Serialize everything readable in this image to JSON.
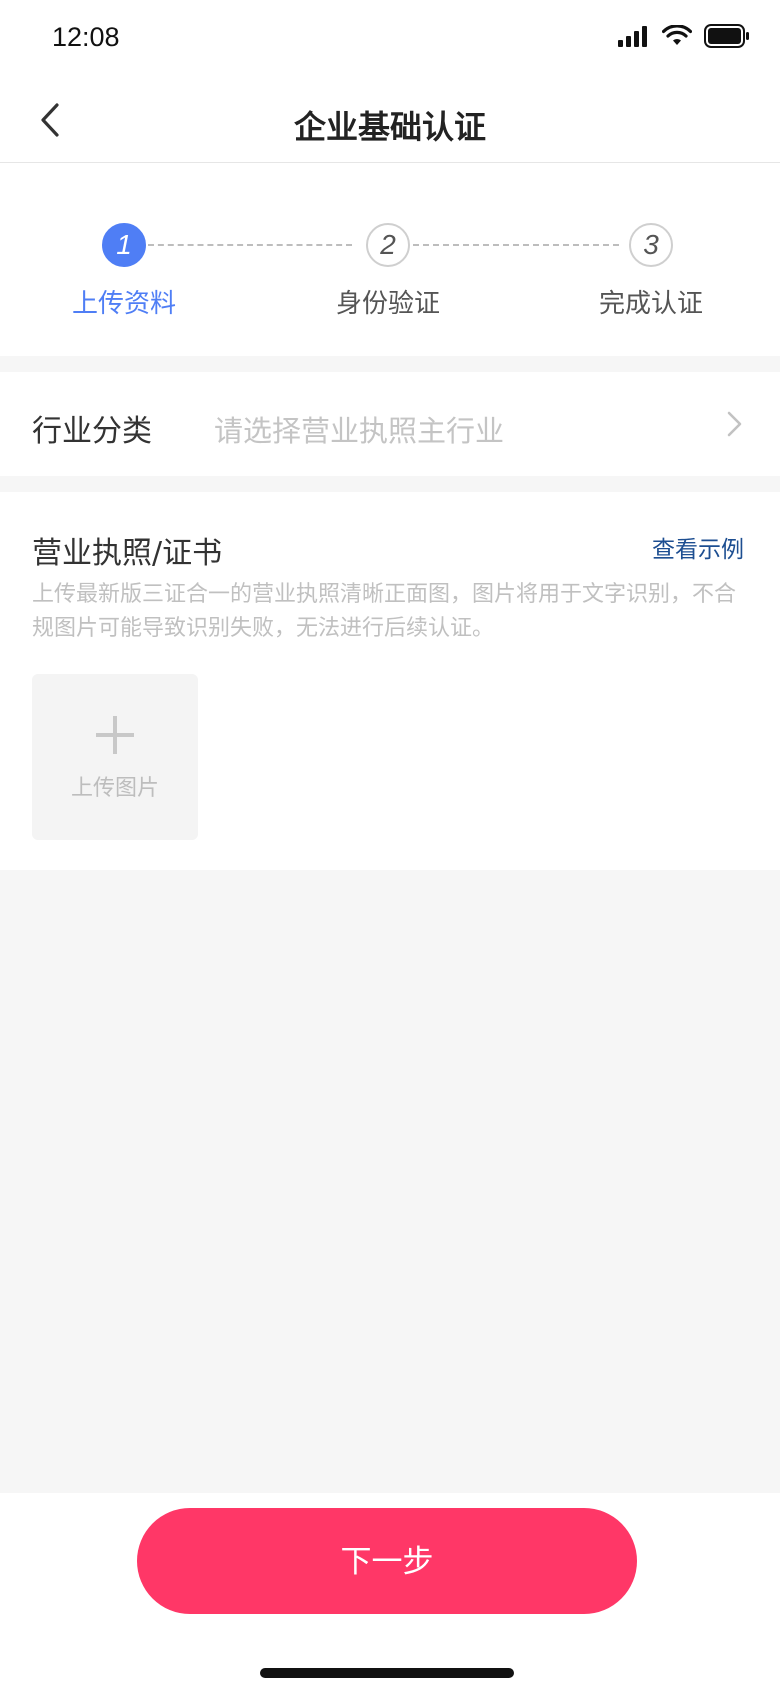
{
  "status_bar": {
    "time": "12:08"
  },
  "nav": {
    "title": "企业基础认证"
  },
  "steps": [
    {
      "number": "1",
      "label": "上传资料",
      "active": true
    },
    {
      "number": "2",
      "label": "身份验证",
      "active": false
    },
    {
      "number": "3",
      "label": "完成认证",
      "active": false
    }
  ],
  "industry": {
    "label": "行业分类",
    "placeholder": "请选择营业执照主行业"
  },
  "license": {
    "title": "营业执照/证书",
    "example_link": "查看示例",
    "description": "上传最新版三证合一的营业执照清晰正面图，图片将用于文字识别，不合规图片可能导致识别失败，无法进行后续认证。",
    "upload_label": "上传图片"
  },
  "footer": {
    "next_button": "下一步"
  },
  "colors": {
    "accent_blue": "#4f7ef5",
    "primary_pink": "#ff3767",
    "link_blue": "#1d4e91"
  }
}
